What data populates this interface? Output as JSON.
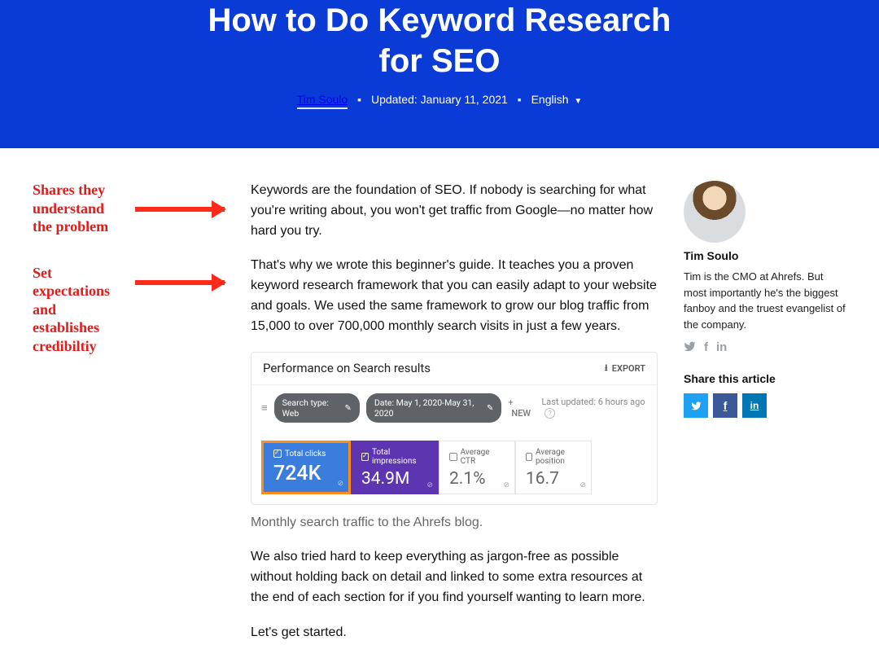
{
  "hero": {
    "title_l1": "How to Do Keyword Research",
    "title_l2": "for SEO",
    "author": "Tim Soulo",
    "updated": "Updated: January 11, 2021",
    "language": "English"
  },
  "annotations": {
    "a1_l1": "Shares they",
    "a1_l2": "understand",
    "a1_l3": "the problem",
    "a2_l1": "Set",
    "a2_l2": "expectations",
    "a2_l3": "and",
    "a2_l4": "establishes",
    "a2_l5": "credibiltiy"
  },
  "article": {
    "p1": "Keywords are the foundation of SEO. If nobody is searching for what you're writing about, you won't get traffic from Google—no matter how hard you try.",
    "p2": "That's why we wrote this beginner's guide. It teaches you a proven keyword research framework that you can easily adapt to your website and goals. We used the same framework to grow our blog traffic from 15,000 to over 700,000 monthly search visits in just a few years.",
    "caption": "Monthly search traffic to the Ahrefs blog.",
    "p3": "We also tried hard to keep everything as jargon-free as possible without holding back on detail and linked to some extra resources at the end of each section for if you find yourself wanting to learn more.",
    "p4": "Let's get started."
  },
  "search_console": {
    "header": "Performance on Search results",
    "export": "EXPORT",
    "chip_type": "Search type: Web",
    "chip_date": "Date: May 1, 2020-May 31, 2020",
    "new_label": "NEW",
    "last_updated": "Last updated: 6 hours ago",
    "metrics": {
      "clicks_label": "Total clicks",
      "clicks_value": "724K",
      "impr_label": "Total impressions",
      "impr_value": "34.9M",
      "ctr_label": "Average CTR",
      "ctr_value": "2.1%",
      "pos_label": "Average position",
      "pos_value": "16.7"
    }
  },
  "sidebar": {
    "author": "Tim Soulo",
    "bio": "Tim is the CMO at Ahrefs. But most importantly he's the biggest fanboy and the truest evangelist of the company.",
    "share_label": "Share this article"
  }
}
